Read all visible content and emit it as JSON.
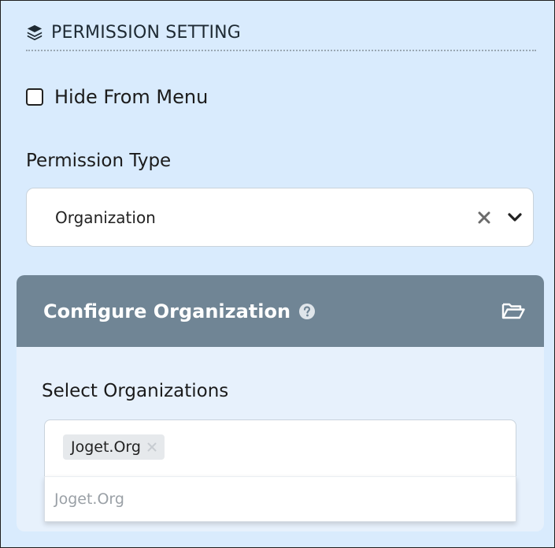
{
  "section": {
    "title": "PERMISSION SETTING",
    "icon": "layers-icon"
  },
  "hide_from_menu": {
    "label": "Hide From Menu",
    "checked": false
  },
  "permission_type": {
    "label": "Permission Type",
    "selected": "Organization"
  },
  "config_panel": {
    "title": "Configure Organization",
    "select_label": "Select Organizations",
    "selected_tags": [
      "Joget.Org"
    ],
    "dropdown_options": [
      "Joget.Org"
    ]
  },
  "colors": {
    "panel_bg": "#d9ebfd",
    "header_bg": "#708595",
    "card_bg": "#e7f1fc"
  }
}
